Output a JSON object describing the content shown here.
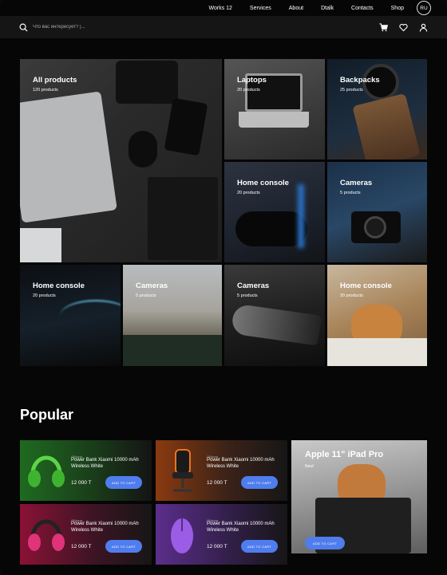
{
  "nav": {
    "items": [
      "Works 12",
      "Services",
      "About",
      "Dtalk",
      "Contacts",
      "Shop"
    ],
    "language": "RU"
  },
  "search": {
    "placeholder": "Что вас интересует? |..."
  },
  "categories": [
    {
      "label": "All products",
      "count": "120 products"
    },
    {
      "label": "Laptops",
      "count": "20 products"
    },
    {
      "label": "Backpacks",
      "count": "25 products"
    },
    {
      "label": "Home console",
      "count": "20 products"
    },
    {
      "label": "Cameras",
      "count": "5 products"
    },
    {
      "label": "Home console",
      "count": "20 products"
    },
    {
      "label": "Cameras",
      "count": "5 products"
    },
    {
      "label": "Cameras",
      "count": "5 products"
    },
    {
      "label": "Home console",
      "count": "20 products"
    }
  ],
  "popular": {
    "title": "Popular",
    "products": [
      {
        "brand": "Обзоры",
        "name": "Power Bank Xiaomi 10000 mAh Wireless White",
        "price": "12 000 Т",
        "button": "ADD TO CART"
      },
      {
        "brand": "Обзоры",
        "name": "Power Bank Xiaomi 10000 mAh Wireless White",
        "price": "12 000 Т",
        "button": "ADD TO CART"
      },
      {
        "brand": "Обзоры",
        "name": "Power Bank Xiaomi 10000 mAh Wireless White",
        "price": "12 000 Т",
        "button": "ADD TO CART"
      },
      {
        "brand": "Обзоры",
        "name": "Power Bank Xiaomi 10000 mAh Wireless White",
        "price": "12 000 Т",
        "button": "ADD TO CART"
      }
    ],
    "featured": {
      "title": "Apple 11\" iPad Pro",
      "badge": "New!",
      "button": "ADD TO CART"
    }
  },
  "colors": {
    "accent": "#4f7dee",
    "background": "#060606"
  },
  "icons": [
    "search-icon",
    "cart-icon",
    "heart-icon",
    "user-icon"
  ]
}
